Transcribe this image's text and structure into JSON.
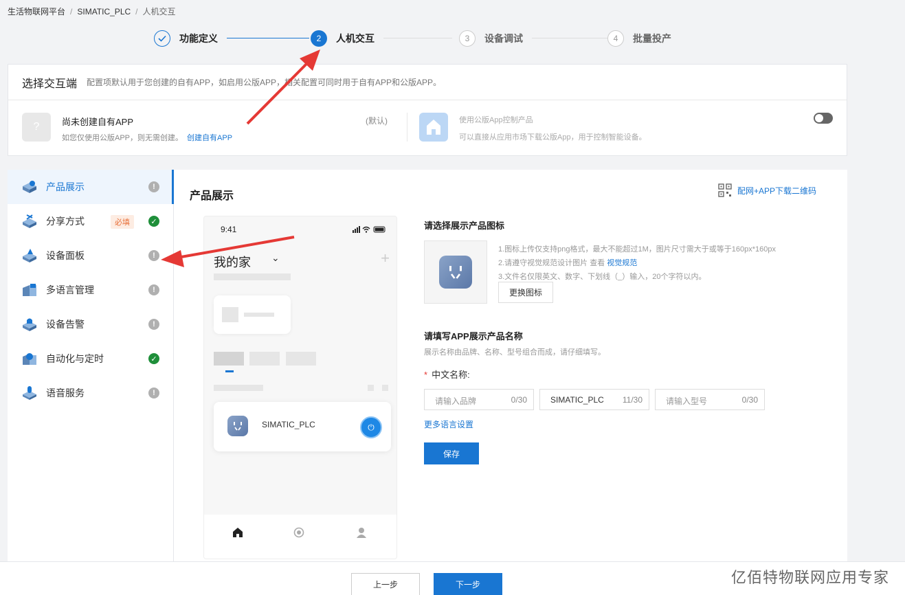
{
  "breadcrumb": {
    "items": [
      "生活物联网平台",
      "SIMATIC_PLC",
      "人机交互"
    ],
    "separator": "/"
  },
  "steps": [
    {
      "num": "✓",
      "label": "功能定义",
      "state": "done"
    },
    {
      "num": "2",
      "label": "人机交互",
      "state": "active"
    },
    {
      "num": "3",
      "label": "设备调试",
      "state": "todo"
    },
    {
      "num": "4",
      "label": "批量投产",
      "state": "todo"
    }
  ],
  "interaction": {
    "title": "选择交互端",
    "desc": "配置项默认用于您创建的自有APP，如启用公版APP，相关配置可同时用于自有APP和公版APP。",
    "own_app": {
      "icon": "?",
      "title": "尚未创建自有APP",
      "sub": "如您仅使用公版APP，则无需创建。",
      "link": "创建自有APP",
      "default_tag": "(默认)"
    },
    "public_app": {
      "title": "使用公版App控制产品",
      "sub": "可以直接从应用市场下载公版App，用于控制智能设备。"
    }
  },
  "sidebar": {
    "items": [
      {
        "label": "产品展示",
        "status": "!",
        "tag": "",
        "icon": "product-display-icon"
      },
      {
        "label": "分享方式",
        "status": "✓",
        "tag": "必填",
        "icon": "share-icon"
      },
      {
        "label": "设备面板",
        "status": "!",
        "tag": "",
        "icon": "device-panel-icon"
      },
      {
        "label": "多语言管理",
        "status": "!",
        "tag": "",
        "icon": "language-icon"
      },
      {
        "label": "设备告警",
        "status": "!",
        "tag": "",
        "icon": "alarm-icon"
      },
      {
        "label": "自动化与定时",
        "status": "✓",
        "tag": "",
        "icon": "automation-icon"
      },
      {
        "label": "语音服务",
        "status": "!",
        "tag": "",
        "icon": "voice-icon"
      }
    ]
  },
  "main": {
    "title": "产品展示",
    "qr_link": "配网+APP下载二维码"
  },
  "phone": {
    "time": "9:41",
    "home_title": "我的家",
    "chevron": "⌄",
    "plus": "+",
    "device_name": "SIMATIC_PLC",
    "power_glyph": "⏻"
  },
  "icon_section": {
    "title": "请选择展示产品图标",
    "hint1": "1.图标上传仅支持png格式，最大不能超过1M，图片尺寸需大于或等于160px*160px",
    "hint2_prefix": "2.请遵守视觉规范设计图片 查看",
    "hint2_link": "视觉规范",
    "hint3": "3.文件名仅限英文、数字、下划线（_）输入，20个字符以内。",
    "change_button": "更换图标"
  },
  "name_section": {
    "title": "请填写APP展示产品名称",
    "hint": "展示名称由品牌、名称、型号组合而成，请仔细填写。",
    "required_star": "*",
    "field_label": "中文名称:",
    "brand": {
      "placeholder": "请输入品牌",
      "value": "",
      "count": "0/30"
    },
    "name": {
      "placeholder": "",
      "value": "SIMATIC_PLC",
      "count": "11/30"
    },
    "model": {
      "placeholder": "请输入型号",
      "value": "",
      "count": "0/30"
    },
    "more_lang": "更多语言设置",
    "save": "保存"
  },
  "footer": {
    "prev": "上一步",
    "next": "下一步"
  },
  "watermark": "亿佰特物联网应用专家",
  "colors": {
    "primary": "#1976d2",
    "success": "#1f8f3a",
    "warn_gray": "#b0b0b0",
    "required_tag": "#e8703a",
    "annotation_arrow": "#e53935"
  }
}
